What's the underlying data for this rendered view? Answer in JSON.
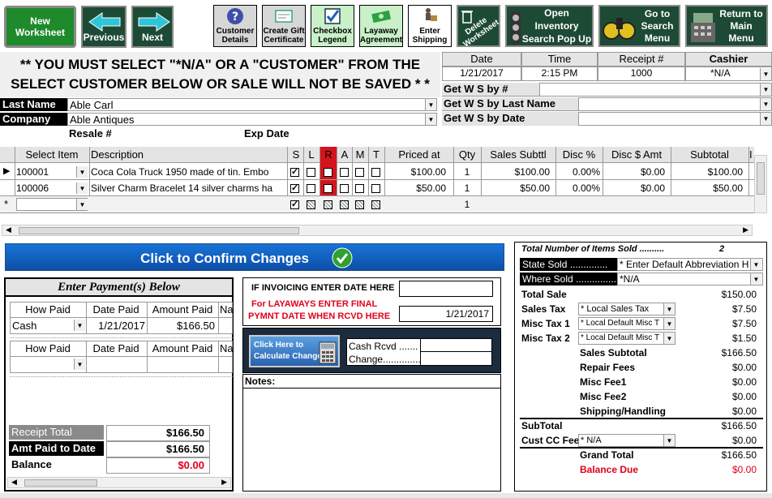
{
  "toolbar": {
    "new_worksheet": "New Worksheet",
    "previous": "Previous",
    "next": "Next",
    "customer_details": [
      "Customer",
      "Details"
    ],
    "gift_cert": [
      "Create Gift",
      "Certificate"
    ],
    "checkbox_legend": [
      "Checkbox",
      "Legend"
    ],
    "layaway": [
      "Layaway",
      "Agreement"
    ],
    "enter_shipping": [
      "Enter",
      "Shipping"
    ],
    "delete_worksheet": [
      "Delete",
      "Worksheet"
    ],
    "open_inventory": [
      "Open",
      "Inventory",
      "Search Pop Up"
    ],
    "goto_search": [
      "Go to",
      "Search",
      "Menu"
    ],
    "return_main": [
      "Return to",
      "Main",
      "Menu"
    ]
  },
  "warning": {
    "line1": "** YOU MUST SELECT \"*N/A\" OR A \"CUSTOMER\" FROM THE",
    "line2": "SELECT CUSTOMER BELOW OR SALE WILL NOT BE SAVED * *"
  },
  "header_info": {
    "date_label": "Date",
    "time_label": "Time",
    "receipt_label": "Receipt #",
    "cashier_label": "Cashier",
    "date": "1/21/2017",
    "time": "2:15 PM",
    "receipt": "1000",
    "cashier": "*N/A",
    "get_ws_num": "Get W S by #",
    "get_ws_last": "Get W S by Last Name",
    "get_ws_date": "Get W S by Date"
  },
  "customer": {
    "last_name_label": "Last Name",
    "last_name": "Able   Carl",
    "company_label": "Company",
    "company": "Able Antiques",
    "resale_label": "Resale #",
    "exp_label": "Exp Date"
  },
  "grid": {
    "headers": [
      "Select Item",
      "Description",
      "S",
      "L",
      "R",
      "A",
      "M",
      "T",
      "Priced at",
      "Qty",
      "Sales Subttl",
      "Disc %",
      "Disc $ Amt",
      "Subtotal",
      "I"
    ],
    "rows": [
      {
        "item": "100001",
        "desc": "Coca Cola Truck 1950 made of tin.  Embo",
        "price": "$100.00",
        "qty": "1",
        "sales": "$100.00",
        "disc_pct": "0.00%",
        "disc_amt": "$0.00",
        "subtotal": "$100.00",
        "marker": "▶"
      },
      {
        "item": "100006",
        "desc": "Silver Charm Bracelet 14 silver charms ha",
        "price": "$50.00",
        "qty": "1",
        "sales": "$50.00",
        "disc_pct": "0.00%",
        "disc_amt": "$0.00",
        "subtotal": "$50.00",
        "marker": ""
      },
      {
        "item": "",
        "desc": "",
        "price": "",
        "qty": "1",
        "sales": "",
        "disc_pct": "",
        "disc_amt": "",
        "subtotal": "",
        "marker": "*"
      }
    ]
  },
  "confirm": "Click to Confirm Changes",
  "payment": {
    "title": "Enter Payment(s) Below",
    "how_paid": "How Paid",
    "date_paid": "Date Paid",
    "amount_paid": "Amount Paid",
    "na": "Na",
    "row1": {
      "how": "Cash",
      "date": "1/21/2017",
      "amount": "$166.50"
    },
    "receipt_total_label": "Receipt Total",
    "receipt_total": "$166.50",
    "amt_paid_label": "Amt Paid to Date",
    "amt_paid": "$166.50",
    "balance_label": "Balance",
    "balance": "$0.00"
  },
  "invoice": {
    "if_invoicing": "IF INVOICING ENTER DATE HERE",
    "layaway_line1": "For LAYAWAYS ENTER FINAL",
    "layaway_line2": "PYMNT DATE WHEN RCVD HERE",
    "layaway_date": "1/21/2017",
    "calc_line1": "Click Here to",
    "calc_line2": "Calculate Change",
    "cash_rcvd": "Cash Rcvd .......",
    "change": "Change..............",
    "notes": "Notes:"
  },
  "totals": {
    "items_label": "Total Number of Items Sold ..........",
    "items": "2",
    "state_sold_label": "State Sold ..............",
    "state_sold": "* Enter Default Abbreviation H",
    "where_sold_label": "Where Sold ...............",
    "where_sold": "*N/A",
    "total_sale_label": "Total Sale",
    "total_sale": "$150.00",
    "sales_tax_label": "Sales Tax",
    "sales_tax_sel": "* Local Sales Tax",
    "sales_tax": "$7.50",
    "misc_tax1_label": "Misc Tax 1",
    "misc_tax1_sel": "* Local Default Misc T",
    "misc_tax1": "$7.50",
    "misc_tax2_label": "Misc Tax 2",
    "misc_tax2_sel": "* Local Default Misc T",
    "misc_tax2": "$1.50",
    "sales_subtotal_label": "Sales Subtotal",
    "sales_subtotal": "$166.50",
    "repair_label": "Repair Fees",
    "repair": "$0.00",
    "misc_fee1_label": "Misc Fee1",
    "misc_fee1": "$0.00",
    "misc_fee2_label": "Misc Fee2",
    "misc_fee2": "$0.00",
    "shipping_label": "Shipping/Handling",
    "shipping": "$0.00",
    "subtotal_label": "SubTotal",
    "subtotal": "$166.50",
    "cc_fee_label": "Cust CC Fee",
    "cc_fee_sel": "* N/A",
    "cc_fee": "$0.00",
    "grand_label": "Grand Total",
    "grand": "$166.50",
    "balance_due_label": "Balance Due",
    "balance_due": "$0.00"
  },
  "colors": {
    "dark_green": "#1d4a35",
    "red_col": "#d4141c",
    "blue_bar": "#1560c8",
    "red_text": "#e0001a"
  }
}
